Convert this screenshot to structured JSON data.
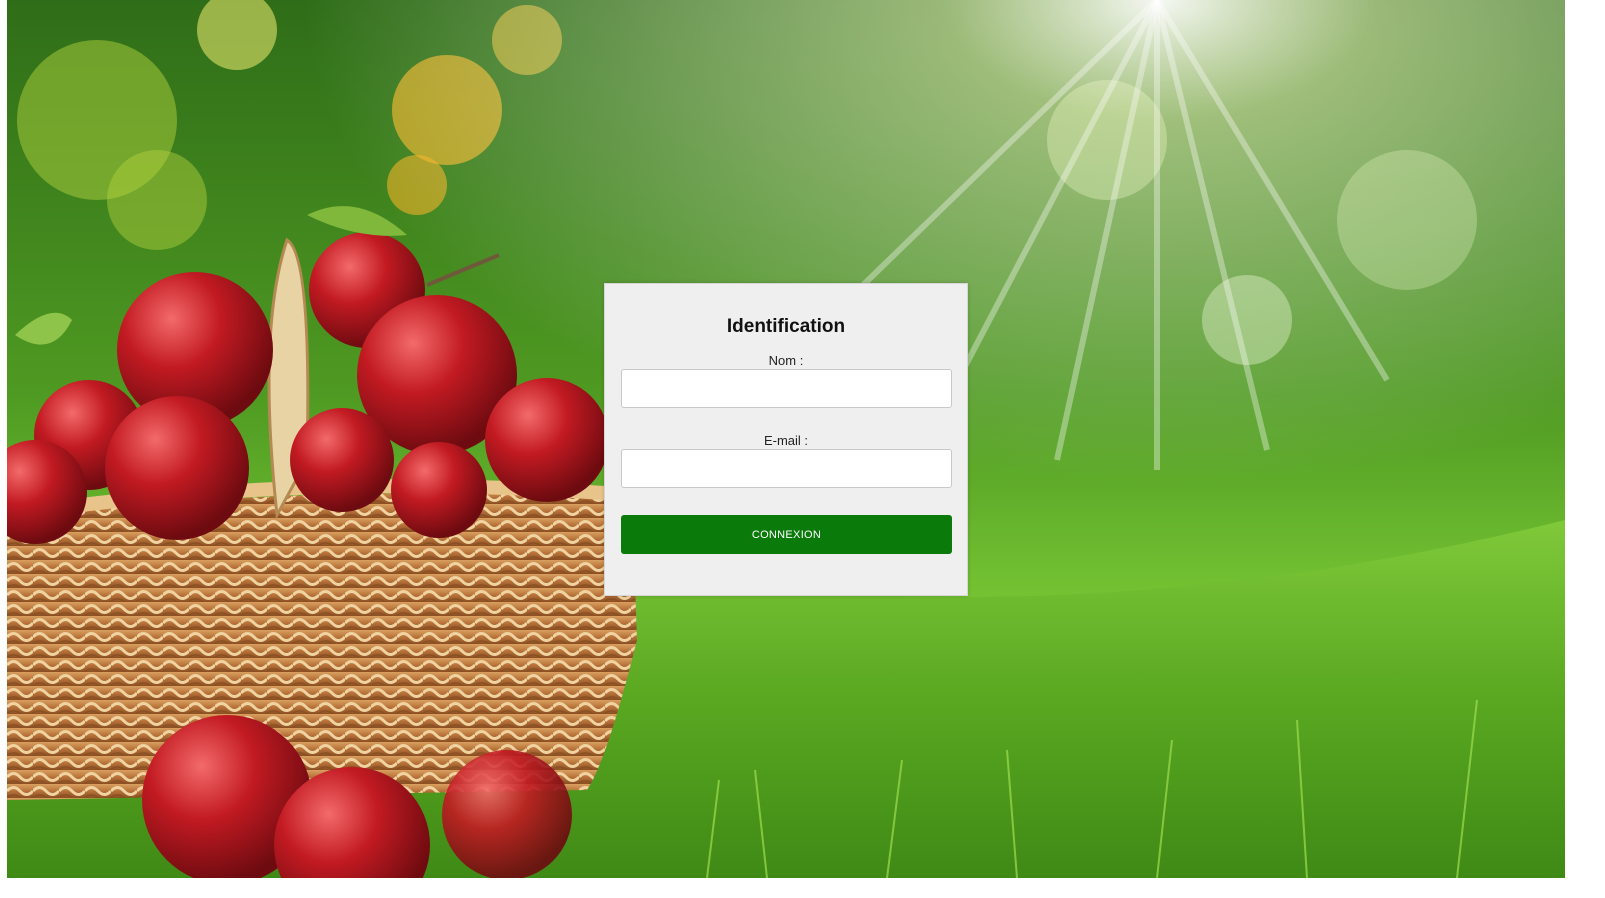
{
  "form": {
    "title": "Identification",
    "name_label": "Nom :",
    "name_value": "",
    "email_label": "E-mail :",
    "email_value": "",
    "submit_label": "CONNEXION"
  },
  "theme": {
    "button_color": "#0a7a0a",
    "card_background": "#efefef"
  },
  "background": {
    "icon": "apple-basket-in-sunlit-grass-photo"
  }
}
